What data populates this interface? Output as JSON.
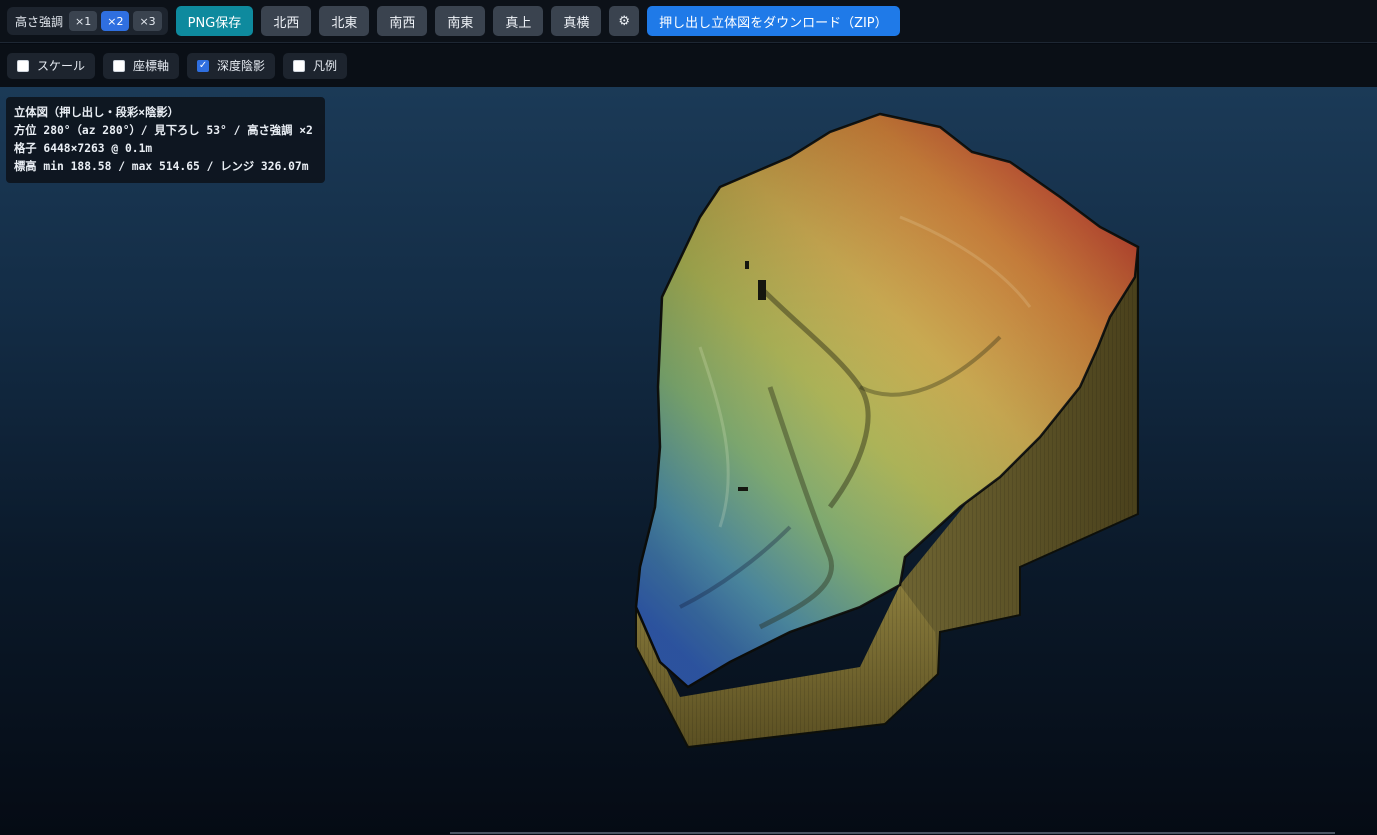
{
  "toolbar": {
    "exaggeration_label": "高さ強調",
    "exaggeration_options": [
      "×1",
      "×2",
      "×3"
    ],
    "exaggeration_selected": "×2",
    "png_save": "PNG保存",
    "view_nw": "北西",
    "view_ne": "北東",
    "view_sw": "南西",
    "view_se": "南東",
    "view_top": "真上",
    "view_side": "真横",
    "settings_glyph": "⚙",
    "download_zip": "押し出し立体図をダウンロード（ZIP）"
  },
  "options": {
    "scale": {
      "label": "スケール",
      "checked": false
    },
    "axes": {
      "label": "座標軸",
      "checked": false
    },
    "depth_shading": {
      "label": "深度陰影",
      "checked": true
    },
    "legend": {
      "label": "凡例",
      "checked": false
    }
  },
  "info": {
    "line1": "立体図（押し出し・段彩×陰影）",
    "line2": "方位 280°（az 280°）/ 見下ろし 53° / 高さ強調 ×2",
    "line3": "格子 6448×7263 @ 0.1m",
    "line4": "標高 min 188.58 / max 514.65 / レンジ 326.07m"
  },
  "colors": {
    "accent_blue": "#2f6fe0",
    "teal": "#0e8a9e",
    "elev_low": "#3a78c8",
    "elev_mid": "#b8b04a",
    "elev_high": "#c8402a"
  }
}
